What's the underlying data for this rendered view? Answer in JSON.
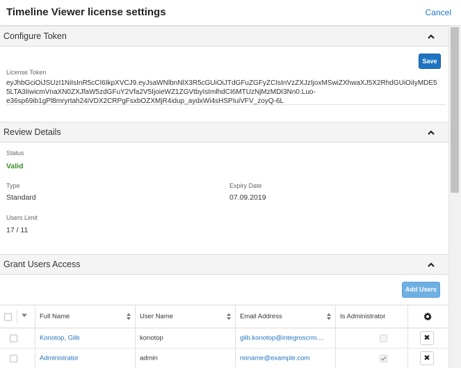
{
  "header": {
    "title": "Timeline Viewer license settings",
    "cancel_label": "Cancel"
  },
  "configure_token": {
    "title": "Configure Token",
    "save_label": "Save",
    "license_label": "License Token",
    "token_lines": [
      "eyJhbGciOiJSUzI1NiIsInR5cCI6IkpXVCJ9.eyJsaWNlbnNlX3R5cGUiOiJTdGFuZGFyZCIsInVzZXJzIjoxMSwiZXhwaXJ5X2RhdGUiOiIyMDE5",
      "5LTA3IiwicmVnaXN0ZXJfaW5zdGFuY2Vfa2V5IjoieWZ1ZGVtbyIsImlhdCI6MTUzNjMzMDI3Nn0.Luo-",
      "e36sp69ib1gPl8mryrtah24iVDX2CRPgFsxbOZXMjR4idup_aydxWi4sHSPIuiVFV_zoyQ-6L"
    ]
  },
  "review_details": {
    "title": "Review Details",
    "status_label": "Status",
    "status_value": "Valid",
    "type_label": "Type",
    "type_value": "Standard",
    "expiry_label": "Expiry Date",
    "expiry_value": "07.09.2019",
    "users_limit_label": "Users Limit",
    "users_limit_value": "17 / 11"
  },
  "grant_access": {
    "title": "Grant Users Access",
    "add_users_label": "Add Users",
    "columns": [
      "Full Name",
      "User Name",
      "Email Address",
      "Is Administrator"
    ],
    "rows": [
      {
        "full_name": "Konotop, Glib",
        "user_name": "konotop",
        "email": "glib.konotop@integroscrm....",
        "is_admin": false
      },
      {
        "full_name": "Administrator",
        "user_name": "admin",
        "email": "noname@example.com",
        "is_admin": true
      }
    ]
  },
  "icons": {
    "collapse": "chevron-up-icon",
    "settings": "gear-icon",
    "remove": "close-icon",
    "sort": "sort-icon"
  },
  "colors": {
    "accent": "#1f74c1",
    "valid": "#3c8f28",
    "add_button": "#6fb0e2"
  }
}
